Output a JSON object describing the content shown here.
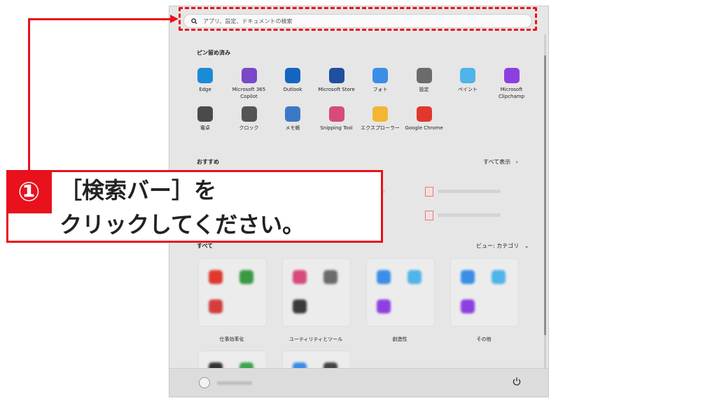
{
  "search": {
    "placeholder": "アプリ、設定、ドキュメントの検索"
  },
  "pinned": {
    "title": "ピン留め済み",
    "apps": [
      {
        "label": "Edge",
        "icon": "edge-icon",
        "color": "#1b8bd6"
      },
      {
        "label": "Microsoft 365\nCopilot",
        "icon": "m365-copilot-icon",
        "color": "#7a48c9"
      },
      {
        "label": "Outlook",
        "icon": "outlook-icon",
        "color": "#1565c0"
      },
      {
        "label": "Microsoft Store",
        "icon": "store-icon",
        "color": "#1f4f9e"
      },
      {
        "label": "フォト",
        "icon": "photos-icon",
        "color": "#3a8ee6"
      },
      {
        "label": "設定",
        "icon": "settings-gear-icon",
        "color": "#6b6b6b"
      },
      {
        "label": "ペイント",
        "icon": "paint-icon",
        "color": "#4fb4e8"
      },
      {
        "label": "Microsoft\nClipchamp",
        "icon": "clipchamp-icon",
        "color": "#8e3fe0"
      },
      {
        "label": "電卓",
        "icon": "calculator-icon",
        "color": "#4a4a4a"
      },
      {
        "label": "クロック",
        "icon": "clock-icon",
        "color": "#555555"
      },
      {
        "label": "メモ帳",
        "icon": "notepad-icon",
        "color": "#3d78c6"
      },
      {
        "label": "Snipping Tool",
        "icon": "snipping-tool-icon",
        "color": "#d64a7e"
      },
      {
        "label": "エクスプローラー",
        "icon": "file-explorer-icon",
        "color": "#f2b632"
      },
      {
        "label": "Google Chrome",
        "icon": "chrome-icon",
        "color": "#e0382f"
      }
    ]
  },
  "recommended": {
    "title": "おすすめ",
    "more_label": "すべて表示"
  },
  "all": {
    "title": "すべて",
    "view_label": "ビュー: カテゴリ",
    "folders": [
      {
        "label": "仕事効率化"
      },
      {
        "label": "ユーティリティとツール"
      },
      {
        "label": "創造性"
      },
      {
        "label": "その他"
      }
    ]
  },
  "callout": {
    "number": "①",
    "line1": "［検索バー］を",
    "line2": "クリックしてください。"
  },
  "colors": {
    "accent": "#e8111c"
  }
}
